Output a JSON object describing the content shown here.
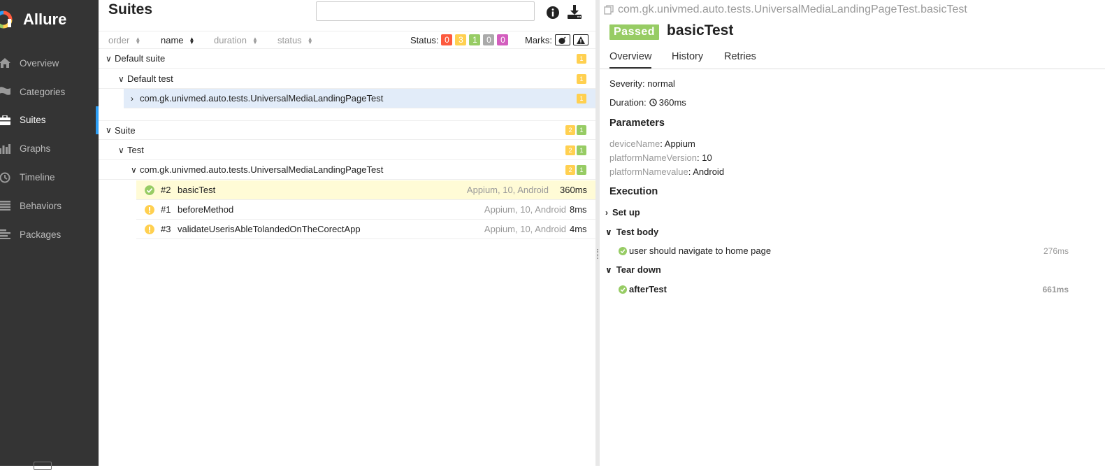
{
  "app": {
    "title": "Allure"
  },
  "sidebar": {
    "items": [
      {
        "label": "Overview",
        "icon": "home-icon"
      },
      {
        "label": "Categories",
        "icon": "flag-icon"
      },
      {
        "label": "Suites",
        "icon": "briefcase-icon",
        "active": true
      },
      {
        "label": "Graphs",
        "icon": "bar-chart-icon"
      },
      {
        "label": "Timeline",
        "icon": "clock-icon"
      },
      {
        "label": "Behaviors",
        "icon": "list-icon"
      },
      {
        "label": "Packages",
        "icon": "align-left-icon"
      }
    ]
  },
  "suites": {
    "title": "Suites",
    "search_value": "",
    "sort": {
      "order": "order",
      "name": "name",
      "duration": "duration",
      "status": "status"
    },
    "status_label": "Status:",
    "status_counts": {
      "failed": "0",
      "broken": "3",
      "passed": "1",
      "skipped": "0",
      "unknown": "0"
    },
    "marks_label": "Marks:",
    "tree": {
      "suite1": {
        "label": "Default suite",
        "badge": "1"
      },
      "test1": {
        "label": "Default test",
        "badge": "1"
      },
      "class1": {
        "label": "com.gk.univmed.auto.tests.UniversalMediaLandingPageTest",
        "badge": "1"
      },
      "suite2": {
        "label": "Suite",
        "badge_broken": "2",
        "badge_passed": "1"
      },
      "test2": {
        "label": "Test",
        "badge_broken": "2",
        "badge_passed": "1"
      },
      "class2": {
        "label": "com.gk.univmed.auto.tests.UniversalMediaLandingPageTest",
        "badge_broken": "2",
        "badge_passed": "1"
      },
      "cases": [
        {
          "num": "#2",
          "name": "basicTest",
          "params": "Appium, 10, Android",
          "duration": "360ms",
          "status": "passed"
        },
        {
          "num": "#1",
          "name": "beforeMethod",
          "params": "Appium, 10, Android",
          "duration": "8ms",
          "status": "broken"
        },
        {
          "num": "#3",
          "name": "validateUserisAbleTolandedOnTheCorectApp",
          "params": "Appium, 10, Android",
          "duration": "4ms",
          "status": "broken"
        }
      ]
    }
  },
  "detail": {
    "fullname": "com.gk.univmed.auto.tests.UniversalMediaLandingPageTest.basicTest",
    "status": "Passed",
    "title": "basicTest",
    "tabs": [
      "Overview",
      "History",
      "Retries"
    ],
    "severity_label": "Severity:",
    "severity": "normal",
    "duration_label": "Duration:",
    "duration": "360ms",
    "parameters_title": "Parameters",
    "parameters": [
      {
        "key": "deviceName",
        "value": "Appium"
      },
      {
        "key": "platformNameVersion",
        "value": "10"
      },
      {
        "key": "platformNamevalue",
        "value": "Android"
      }
    ],
    "execution_title": "Execution",
    "setup_label": "Set up",
    "body_label": "Test body",
    "body_step": {
      "name": "user should navigate to home page",
      "duration": "276ms"
    },
    "teardown_label": "Tear down",
    "teardown_step": {
      "name": "afterTest",
      "duration": "661ms"
    }
  },
  "colors": {
    "failed": "#fd5a3e",
    "broken": "#ffd050",
    "passed": "#97cc64",
    "skipped": "#aaaaaa",
    "unknown": "#d35ebe",
    "sidebar": "#343434",
    "accent": "#2d9ef5"
  }
}
